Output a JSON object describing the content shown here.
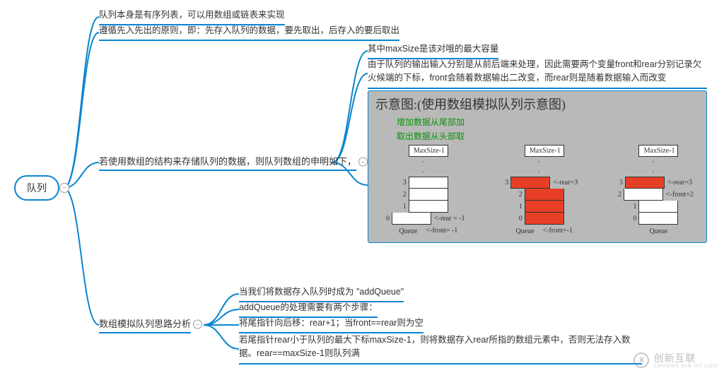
{
  "root": {
    "label": "队列"
  },
  "n1": "队列本身是有序列表，可以用数组或链表来实现",
  "n2": "遵循先入先出的原则，即：先存入队列的数据，要先取出，后存入的要后取出",
  "n3": {
    "label": "若使用数组的结构来存储队列的数据，则队列数组的申明如下，"
  },
  "n3a": "其中maxSize是该对哦的最大容量",
  "n3b": "由于队列的输出输入分别是从前后端来处理，因此需要两个变量front和rear分别记录欠火候端的下标，front会随着数据输出二改变，而rear则是随着数据输入而改变",
  "n4": {
    "label": "数组模拟队列思路分析"
  },
  "n4a": "当我们将数据存入队列时成为  \"addQueue\"",
  "n4b": "addQueue的处理需要有两个步骤：",
  "n4c": "将尾指针向后移：rear+1；当front==rear则为空",
  "n4d": "若尾指针rear小于队列的最大下标maxSize-1，则将数据存入rear所指的数组元素中，否则无法存入数据。rear==maxSize-1则队列满",
  "diagram": {
    "title": "示意图:(使用数组模拟队列示意图)",
    "note1": "增加数据从尾部加",
    "note2": "取出数据从头部取",
    "maxLabel": "MaxSize-1",
    "queueLabel": "Queue",
    "q1": {
      "rear": "<-rear = -1",
      "front": "<-front= -1"
    },
    "q2": {
      "rear": "<-rear=3",
      "front": "<-front=-1"
    },
    "q3": {
      "rear": "<-rear=3",
      "front": "<-front=2"
    }
  },
  "watermark": {
    "brand": "创新互联",
    "sub": "CHUANG XIN HU LIAN"
  }
}
